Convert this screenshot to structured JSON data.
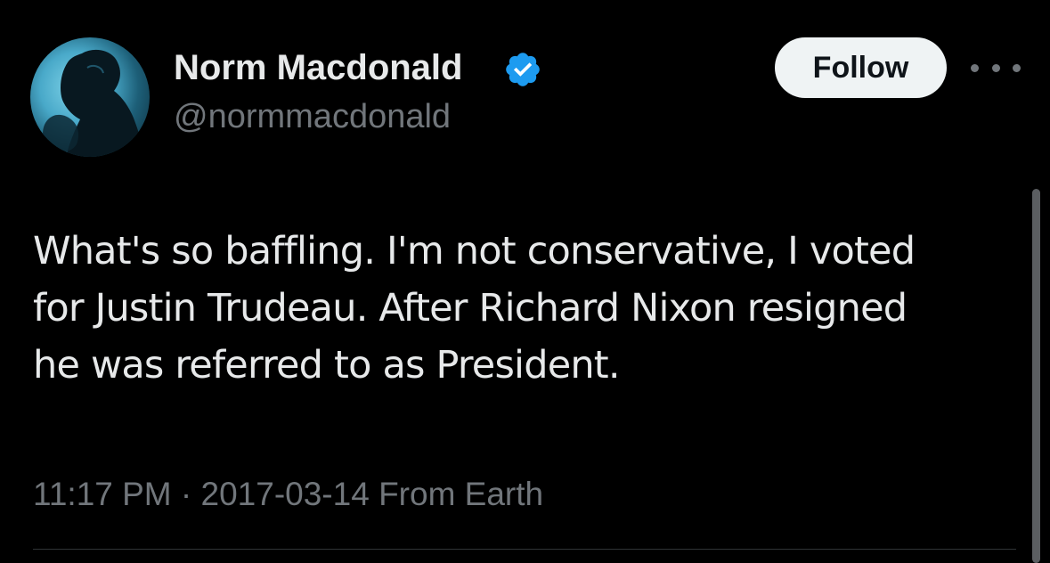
{
  "author": {
    "display_name": "Norm Macdonald",
    "handle": "@normmacdonald",
    "verified": true,
    "avatar_icon": "profile-photo"
  },
  "actions": {
    "follow_label": "Follow",
    "more_icon": "more-horizontal-icon"
  },
  "tweet": {
    "lines": [
      "What's so baffling. I'm not conservative, I voted",
      "for Justin Trudeau. After Richard Nixon resigned",
      "he was referred to as President."
    ]
  },
  "meta": {
    "time": "11:17 PM",
    "separator": "·",
    "date": "2017-03-14",
    "source": "From Earth"
  },
  "colors": {
    "background": "#000000",
    "text_primary": "#e7e9ea",
    "text_secondary": "#71767b",
    "verified_blue": "#1d9bf0",
    "follow_button_bg": "#eff3f4"
  }
}
